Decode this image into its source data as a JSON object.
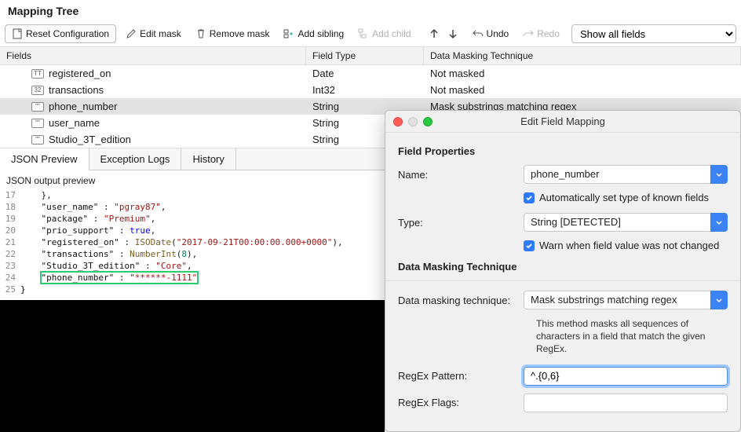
{
  "panel_title": "Mapping Tree",
  "toolbar": {
    "reset": "Reset Configuration",
    "edit_mask": "Edit mask",
    "remove_mask": "Remove mask",
    "add_sibling": "Add sibling",
    "add_child": "Add child",
    "undo": "Undo",
    "redo": "Redo",
    "show_fields": "Show all fields"
  },
  "cols": {
    "fields": "Fields",
    "type": "Field Type",
    "mask": "Data Masking Technique"
  },
  "rows": [
    {
      "name": "registered_on",
      "type": "Date",
      "mask": "Not masked"
    },
    {
      "name": "transactions",
      "type": "Int32",
      "mask": "Not masked"
    },
    {
      "name": "phone_number",
      "type": "String",
      "mask": "Mask substrings matching regex"
    },
    {
      "name": "user_name",
      "type": "String",
      "mask": ""
    },
    {
      "name": "Studio_3T_edition",
      "type": "String",
      "mask": ""
    }
  ],
  "tabs": {
    "json": "JSON Preview",
    "exc": "Exception Logs",
    "hist": "History"
  },
  "json_title": "JSON output preview",
  "code": {
    "l17": "    },",
    "l18_k": "\"user_name\"",
    "l18_v": "\"pgray87\"",
    "l19_k": "\"package\"",
    "l19_v": "\"Premium\"",
    "l20_k": "\"prio_support\"",
    "l20_v": "true",
    "l21_k": "\"registered_on\"",
    "l21_fn": "ISODate",
    "l21_arg": "\"2017-09-21T00:00:00.000+0000\"",
    "l22_k": "\"transactions\"",
    "l22_fn": "NumberInt",
    "l22_arg": "8",
    "l23_k": "\"Studio_3T_edition\"",
    "l23_v": "\"Core\"",
    "l24_k": "\"phone_number\"",
    "l24_v": "\"******-1111\"",
    "l25": "}"
  },
  "ln": {
    "17": "17",
    "18": "18",
    "19": "19",
    "20": "20",
    "21": "21",
    "22": "22",
    "23": "23",
    "24": "24",
    "25": "25"
  },
  "dialog": {
    "title": "Edit Field Mapping",
    "sec1": "Field Properties",
    "name_lbl": "Name:",
    "name_val": "phone_number",
    "auto_set": "Automatically set type of known fields",
    "type_lbl": "Type:",
    "type_val": "String [DETECTED]",
    "warn": "Warn when field value was not changed",
    "sec2": "Data Masking Technique",
    "dmt_lbl": "Data masking technique:",
    "dmt_val": "Mask substrings matching regex",
    "dmt_desc": "This method masks all sequences of characters in a field that match the given RegEx.",
    "regex_lbl": "RegEx Pattern:",
    "regex_val": "^.{0,6}",
    "flags_lbl": "RegEx Flags:",
    "flags_val": ""
  }
}
